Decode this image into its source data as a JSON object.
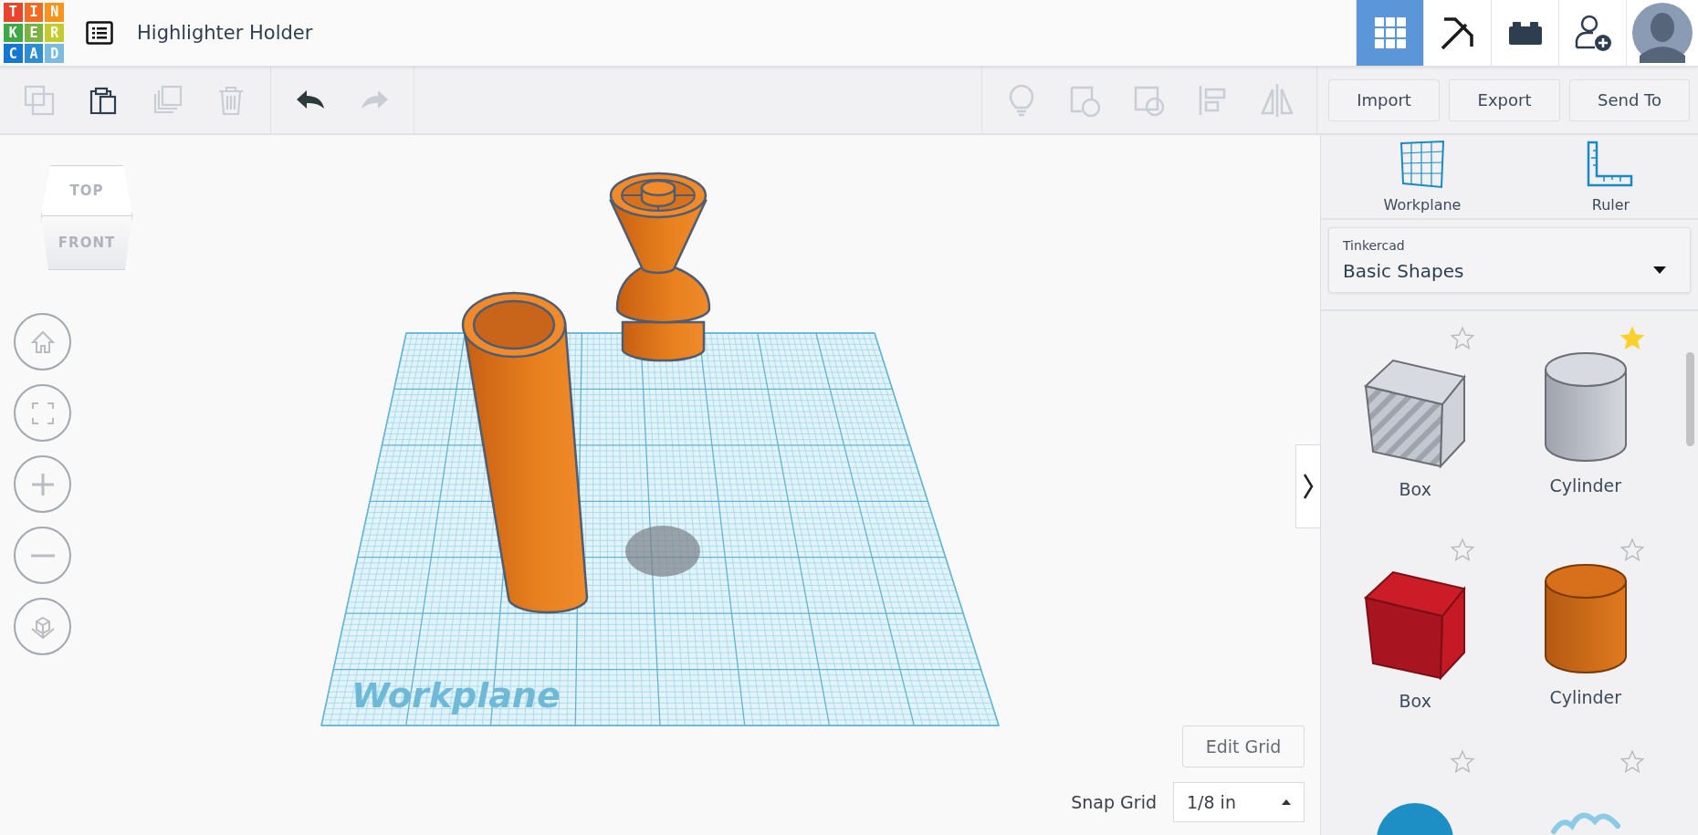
{
  "logo": {
    "letters": [
      "T",
      "I",
      "N",
      "K",
      "E",
      "R",
      "C",
      "A",
      "D"
    ]
  },
  "project": {
    "title": "Highlighter Holder"
  },
  "top_nav": [
    {
      "kind": "grid",
      "selected": true
    },
    {
      "kind": "pickaxe",
      "selected": false
    },
    {
      "kind": "bricks",
      "selected": false
    },
    {
      "kind": "add-user",
      "selected": false
    }
  ],
  "toolbar": {
    "edit_tools": [
      {
        "kind": "copy",
        "disabled": true
      },
      {
        "kind": "paste",
        "disabled": false
      },
      {
        "kind": "duplicate",
        "disabled": true
      },
      {
        "kind": "delete",
        "disabled": true
      }
    ],
    "history": [
      {
        "kind": "undo",
        "disabled": false
      },
      {
        "kind": "redo",
        "disabled": true
      }
    ],
    "shape_tools": [
      {
        "kind": "bulb",
        "disabled": true
      },
      {
        "kind": "group",
        "disabled": true
      },
      {
        "kind": "hole",
        "disabled": true
      },
      {
        "kind": "align",
        "disabled": true
      },
      {
        "kind": "mirror",
        "disabled": true
      }
    ],
    "buttons": [
      "Import",
      "Export",
      "Send To"
    ]
  },
  "view_cube": {
    "top": "TOP",
    "front": "FRONT"
  },
  "nav_controls": [
    {
      "kind": "home"
    },
    {
      "kind": "fit"
    },
    {
      "kind": "zoom-in"
    },
    {
      "kind": "zoom-out"
    },
    {
      "kind": "ortho"
    }
  ],
  "scene": {
    "workplane_label": "Workplane"
  },
  "edit_grid_button": "Edit Grid",
  "snap_grid": {
    "label": "Snap Grid",
    "value": "1/8 in"
  },
  "panel": {
    "tools": [
      {
        "kind": "workplane",
        "label": "Workplane"
      },
      {
        "kind": "ruler",
        "label": "Ruler"
      }
    ],
    "library": {
      "provider": "Tinkercad",
      "name": "Basic Shapes"
    },
    "shapes": [
      {
        "kind": "box-hole",
        "label": "Box",
        "favorite": false
      },
      {
        "kind": "cylinder-hole",
        "label": "Cylinder",
        "favorite": true
      },
      {
        "kind": "box",
        "label": "Box",
        "favorite": false
      },
      {
        "kind": "cylinder",
        "label": "Cylinder",
        "favorite": false
      },
      {
        "kind": "sphere",
        "favorite": false
      },
      {
        "kind": "scribble",
        "favorite": false
      }
    ]
  }
}
